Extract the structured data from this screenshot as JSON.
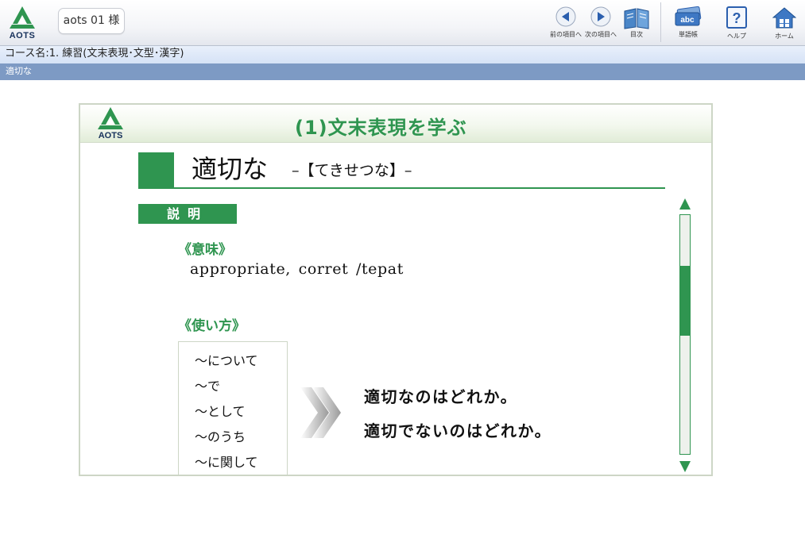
{
  "header": {
    "logo_text": "AOTS",
    "user_label": "aots 01 様",
    "toolbar": [
      {
        "id": "prev",
        "label": "前の項目へ",
        "icon": "prev-arrow-icon"
      },
      {
        "id": "next",
        "label": "次の項目へ",
        "icon": "next-arrow-icon"
      },
      {
        "id": "contents",
        "label": "目次",
        "icon": "book-icon"
      },
      {
        "id": "vocab",
        "label": "単語帳",
        "icon": "vocabulary-cards-icon"
      },
      {
        "id": "help",
        "label": "ヘルプ",
        "icon": "help-icon"
      },
      {
        "id": "home",
        "label": "ホーム",
        "icon": "home-icon"
      }
    ]
  },
  "course": {
    "name": "コース名:1. 練習(文末表現･文型･漢字)",
    "section": "適切な"
  },
  "lesson": {
    "logo_text": "AOTS",
    "title": "(1)文末表現を学ぶ",
    "heading": "適切な",
    "reading": "–【てきせつな】–",
    "explanation_label": "説明",
    "meaning_label": "《意味》",
    "meaning_text": "appropriate, corret  /tepat",
    "usage_label": "《使い方》",
    "usage_patterns": [
      "〜について",
      "〜で",
      "〜として",
      "〜のうち",
      "〜に関して"
    ],
    "examples": [
      "適切なのはどれか。",
      "適切でないのはどれか。"
    ]
  },
  "scrollbar": {
    "position": 0.3
  },
  "colors": {
    "accent_green": "#2f9550",
    "section_bar": "#7d9ac4",
    "course_bar": "#dde8f8",
    "logo_navy": "#17315b"
  }
}
